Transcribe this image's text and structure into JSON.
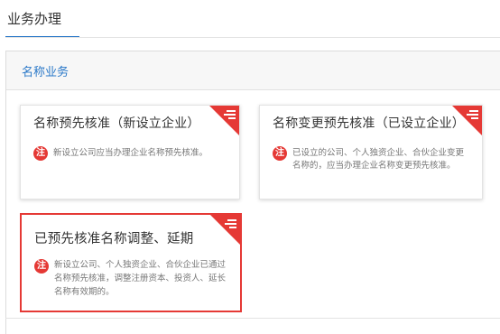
{
  "top_tab": {
    "label": "业务办理"
  },
  "panel": {
    "title": "名称业务",
    "cards": [
      {
        "title": "名称预先核准（新设立企业）",
        "note_badge": "注",
        "note": "新设立公司应当办理企业名称预先核准。",
        "selected": false
      },
      {
        "title": "名称变更预先核准（已设立企业）",
        "note_badge": "注",
        "note": "已设立的公司、个人独资企业、合伙企业变更名称的，应当办理企业名称变更预先核准。",
        "selected": false
      },
      {
        "title": "已预先核准名称调整、延期",
        "note_badge": "注",
        "note": "新设立公司、个人独资企业、合伙企业已通过名称预先核准，调整注册资本、投资人、延长名称有效期的。",
        "selected": true
      }
    ]
  },
  "colors": {
    "accent_blue": "#2a78c8",
    "accent_red": "#e53935"
  },
  "icons": {
    "corner": "menu-lines-icon",
    "note": "note-badge-icon"
  }
}
